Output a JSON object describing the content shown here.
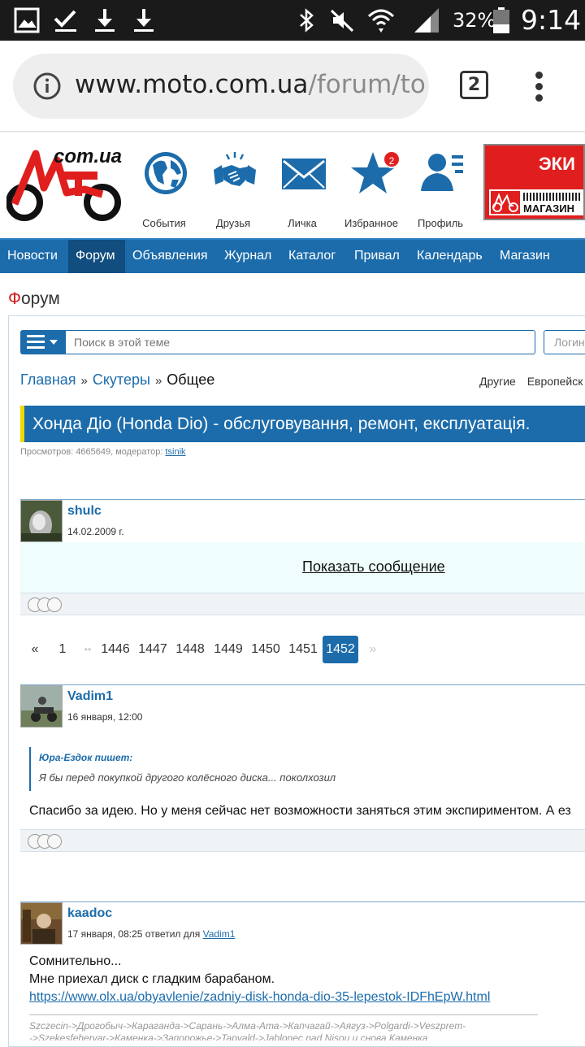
{
  "status_bar": {
    "battery": "32%",
    "time": "9:14",
    "icons": [
      "gallery-icon",
      "check-icon",
      "download-icon",
      "download-icon",
      "bluetooth-icon",
      "mute-icon",
      "wifi-icon",
      "signal-icon",
      "battery-icon"
    ]
  },
  "browser": {
    "url_host": "www.moto.com.ua",
    "url_path": "/forum/top",
    "tab_count": "2"
  },
  "header": {
    "logo_text": "com.ua",
    "items": [
      {
        "label": "События",
        "icon": "globe-icon"
      },
      {
        "label": "Друзья",
        "icon": "handshake-icon"
      },
      {
        "label": "Личка",
        "icon": "envelope-icon"
      },
      {
        "label": "Избранное",
        "icon": "star-icon",
        "badge": "2"
      },
      {
        "label": "Профиль",
        "icon": "profile-icon"
      }
    ],
    "banner_top": "ЭКИ",
    "banner_bottom": "МАГАЗИН"
  },
  "nav": {
    "items": [
      "Новости",
      "Форум",
      "Объявления",
      "Журнал",
      "Каталог",
      "Привал",
      "Календарь",
      "Магазин"
    ],
    "active": "Форум"
  },
  "page": {
    "title_first": "Ф",
    "title_rest": "орум",
    "search_placeholder": "Поиск в этой теме",
    "login_placeholder": "Логин",
    "breadcrumb": {
      "home": "Главная",
      "section": "Скутеры",
      "current": "Общее",
      "sep": "»"
    },
    "crumb_right": [
      "Другие",
      "Европейск"
    ],
    "thread_title": "Хонда Діо (Honda Dio) - обслуговування, ремонт, експлуатація.",
    "meta_prefix": "Просмотров: 4665649, модератор:",
    "moderator": "tsinik"
  },
  "posts": [
    {
      "author": "shulc",
      "date": "14.02.2009 г.",
      "show_message": "Показать сообщение"
    },
    {
      "author": "Vadim1",
      "date": "16 января, 12:00",
      "quote_author": "Юра-Ездок пишет:",
      "quote_text": "Я бы перед покупкой другого колёсного диска... поколхозил",
      "text": "Спасибо за идею. Но у меня сейчас нет возможности заняться этим экспириментом. А ез"
    },
    {
      "author": "kaadoc",
      "date_prefix": "17 января, 08:25 ответил для",
      "date_link": "Vadim1",
      "line1": "Сомнительно...",
      "line2": "Мне приехал диск с гладким барабаном.",
      "link": "https://www.olx.ua/obyavlenie/zadniy-disk-honda-dio-35-lepestok-IDFhEpW.html",
      "sig1": "Szczecin->Дрогобыч->Караганда->Сарань->Алма-Ата->Капчагай->Аягуз->Polgardi->Veszprem-",
      "sig2": "->Szekesfehervar->Каменка->Запорожье->Tapvald->Jablonec nad Nisou и снова Каменка"
    }
  ],
  "pagination": {
    "prev": "«",
    "pages": [
      "1",
      "1446",
      "1447",
      "1448",
      "1449",
      "1450",
      "1451",
      "1452"
    ],
    "ellipsis": "••",
    "next": "»",
    "current": "1452"
  }
}
